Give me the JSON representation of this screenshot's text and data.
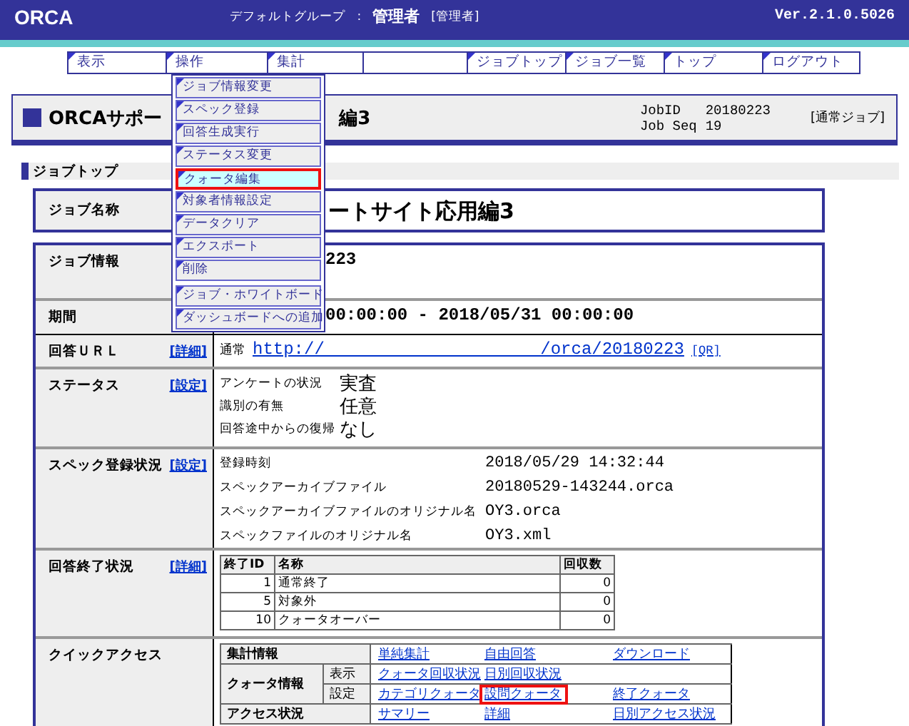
{
  "header": {
    "logo": "ORCA",
    "group": "デフォルトグループ",
    "separator": ":",
    "user": "管理者",
    "role": "[管理者]",
    "version": "Ver.2.1.0.5026"
  },
  "nav": [
    {
      "kind": "tab",
      "label": "表示"
    },
    {
      "kind": "tab",
      "label": "操作"
    },
    {
      "kind": "tab",
      "label": "集計"
    },
    {
      "kind": "blank"
    },
    {
      "kind": "tab",
      "label": "ジョブトップ"
    },
    {
      "kind": "tab",
      "label": "ジョブ一覧"
    },
    {
      "kind": "tab",
      "label": "トップ"
    },
    {
      "kind": "tab",
      "label": "ログアウト"
    }
  ],
  "menu": [
    [
      {
        "label": "ジョブ情報変更",
        "selected": false
      },
      {
        "label": "スペック登録",
        "selected": false
      },
      {
        "label": "回答生成実行",
        "selected": false
      },
      {
        "label": "ステータス変更",
        "selected": false
      },
      {
        "label": "クォータ編集",
        "selected": true
      },
      {
        "label": "対象者情報設定",
        "selected": false
      },
      {
        "label": "データクリア",
        "selected": false
      },
      {
        "label": "エクスポート",
        "selected": false
      },
      {
        "label": "削除",
        "selected": false
      }
    ],
    [
      {
        "label": "ジョブ・ホワイトボード",
        "selected": false
      },
      {
        "label": "ダッシュボードへの追加",
        "selected": false
      }
    ]
  ],
  "title": {
    "text_left": "ORCAサポー",
    "text_right": "編3",
    "job_id_label": "JobID",
    "job_id": "20180223",
    "job_seq_label": "Job Seq",
    "job_seq": "19",
    "job_type": "[通常ジョブ]"
  },
  "section": "ジョブトップ",
  "job_name": {
    "label": "ジョブ名称",
    "value": "ートサイト応用編3"
  },
  "rows": [
    {
      "kind": "text",
      "label": "ジョブ情報",
      "value": "223"
    },
    {
      "kind": "text",
      "label": "期間",
      "value": "00:00:00 - 2018/05/31 00:00:00"
    },
    {
      "kind": "url",
      "label": "回答ＵＲＬ",
      "action": "[詳細]",
      "prefix": "通常",
      "url": "http://                     /orca/20180223",
      "qr": "[QR]"
    },
    {
      "kind": "pairs",
      "label": "ステータス",
      "action": "[設定]",
      "large": true,
      "pairs": [
        [
          "アンケートの状況",
          "実査"
        ],
        [
          "識別の有無",
          "任意"
        ],
        [
          "回答途中からの復帰",
          "なし"
        ]
      ]
    },
    {
      "kind": "pairs",
      "label": "スペック登録状況",
      "action": "[設定]",
      "large": false,
      "pairs": [
        [
          "登録時刻",
          "2018/05/29 14:32:44"
        ],
        [
          "スペックアーカイブファイル",
          "20180529-143244.orca"
        ],
        [
          "スペックアーカイブファイルのオリジナル名",
          "OY3.orca"
        ],
        [
          "スペックファイルのオリジナル名",
          "OY3.xml"
        ]
      ]
    },
    {
      "kind": "table",
      "label": "回答終了状況",
      "action": "[詳細]",
      "columns": [
        "終了ID",
        "名称",
        "回収数"
      ],
      "table_rows": [
        [
          "1",
          "通常終了",
          "0"
        ],
        [
          "5",
          "対象外",
          "0"
        ],
        [
          "10",
          "クォータオーバー",
          "0"
        ]
      ]
    },
    {
      "kind": "quick",
      "label": "クイックアクセス",
      "groups": [
        {
          "label": "集計情報",
          "lines": [
            {
              "links": [
                {
                  "text": "単純集計",
                  "highlighted": false
                },
                {
                  "text": "自由回答",
                  "highlighted": false
                },
                {
                  "text": "ダウンロード",
                  "highlighted": false
                }
              ]
            }
          ]
        },
        {
          "label": "クォータ情報",
          "lines": [
            {
              "sub": "表示",
              "links": [
                {
                  "text": "クォータ回収状況",
                  "highlighted": false
                },
                {
                  "text": "日別回収状況",
                  "highlighted": false
                }
              ]
            },
            {
              "sub": "設定",
              "links": [
                {
                  "text": "カテゴリクォータ",
                  "highlighted": false
                },
                {
                  "text": "設問クォータ",
                  "highlighted": true
                },
                {
                  "text": "終了クォータ",
                  "highlighted": false
                }
              ]
            }
          ]
        },
        {
          "label": "アクセス状況",
          "lines": [
            {
              "links": [
                {
                  "text": "サマリー",
                  "highlighted": false
                },
                {
                  "text": "詳細",
                  "highlighted": false
                },
                {
                  "text": "日別アクセス状況",
                  "highlighted": false
                }
              ]
            }
          ]
        }
      ]
    }
  ]
}
